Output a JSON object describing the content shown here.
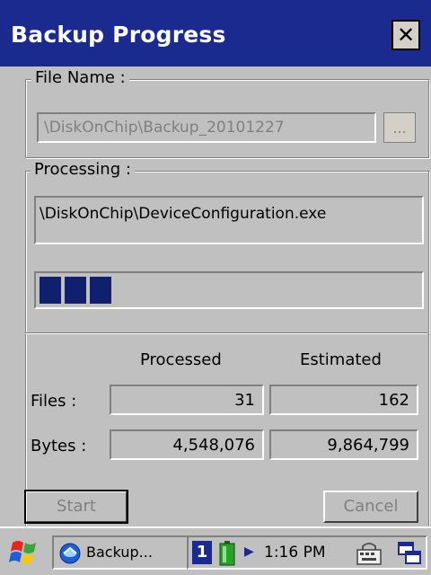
{
  "window": {
    "title": "Backup Progress",
    "close_icon": "close-icon"
  },
  "file_group": {
    "label": "File Name :",
    "path": "\\DiskOnChip\\Backup_20101227",
    "browse_label": "..."
  },
  "processing_group": {
    "label": "Processing :",
    "current_file": "\\DiskOnChip\\DeviceConfiguration.exe",
    "progress_fraction": 0.19,
    "progress_color": "#10206f"
  },
  "stats": {
    "col_processed": "Processed",
    "col_estimated": "Estimated",
    "rows": [
      {
        "label": "Files :",
        "processed": "31",
        "estimated": "162"
      },
      {
        "label": "Bytes :",
        "processed": "4,548,076",
        "estimated": "9,864,799"
      }
    ]
  },
  "buttons": {
    "start": "Start",
    "cancel": "Cancel"
  },
  "taskbar": {
    "start_icon": "windows-flag-icon",
    "task_label": "Backup...",
    "tray_number": "1",
    "time": "1:16 PM",
    "keyboard_icon": "keyboard-icon",
    "desktop_icon": "windows-switch-icon"
  },
  "colors": {
    "title_bar": "#1a2a8e",
    "window_bg": "#c0c0c0",
    "disabled_text": "#808080"
  }
}
